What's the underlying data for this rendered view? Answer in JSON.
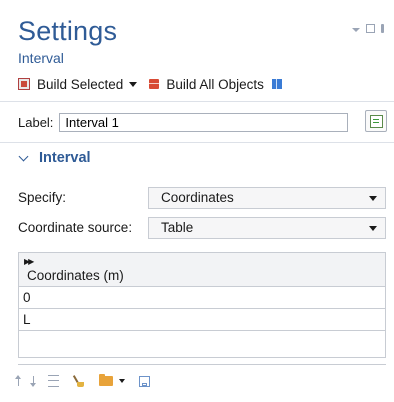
{
  "panel": {
    "title": "Settings",
    "subtitle": "Interval"
  },
  "toolbar": {
    "build_selected_label": "Build Selected",
    "build_all_label": "Build All Objects"
  },
  "label_field": {
    "label": "Label:",
    "value": "Interval 1"
  },
  "section": {
    "title": "Interval"
  },
  "form": {
    "specify_label": "Specify:",
    "specify_value": "Coordinates",
    "source_label": "Coordinate source:",
    "source_value": "Table"
  },
  "table": {
    "column_header": "Coordinates (m)",
    "rows": [
      "0",
      "L",
      ""
    ]
  },
  "icons": {
    "window": [
      "menu-icon",
      "maximize-icon",
      "pin-icon"
    ],
    "bottom": [
      "move-up-icon",
      "move-down-icon",
      "delete-rows-icon",
      "clear-table-icon",
      "load-from-file-icon",
      "save-to-file-icon"
    ]
  },
  "colors": {
    "accent": "#2f5b96",
    "border": "#c8ccd3"
  }
}
